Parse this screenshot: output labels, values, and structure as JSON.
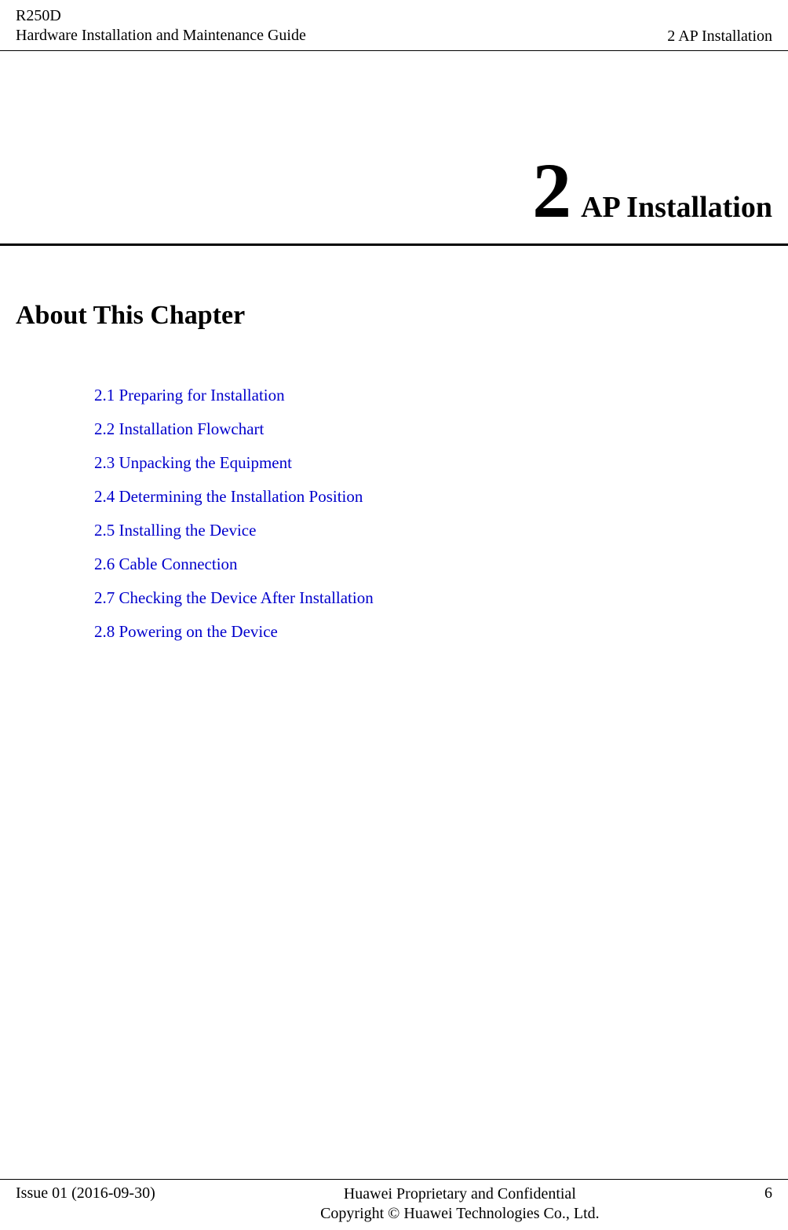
{
  "header": {
    "product": "R250D",
    "doc_title": "Hardware Installation and Maintenance Guide",
    "section": "2 AP Installation"
  },
  "chapter": {
    "number": "2",
    "name": "AP Installation"
  },
  "about_heading": "About This Chapter",
  "toc": [
    {
      "label": "2.1 Preparing for Installation"
    },
    {
      "label": "2.2 Installation Flowchart"
    },
    {
      "label": "2.3 Unpacking the Equipment"
    },
    {
      "label": "2.4 Determining the Installation Position"
    },
    {
      "label": "2.5 Installing the Device"
    },
    {
      "label": "2.6 Cable Connection"
    },
    {
      "label": "2.7 Checking the Device After Installation"
    },
    {
      "label": "2.8 Powering on the Device"
    }
  ],
  "footer": {
    "issue": "Issue 01 (2016-09-30)",
    "confidential_line1": "Huawei Proprietary and Confidential",
    "confidential_line2": "Copyright © Huawei Technologies Co., Ltd.",
    "page_number": "6"
  }
}
